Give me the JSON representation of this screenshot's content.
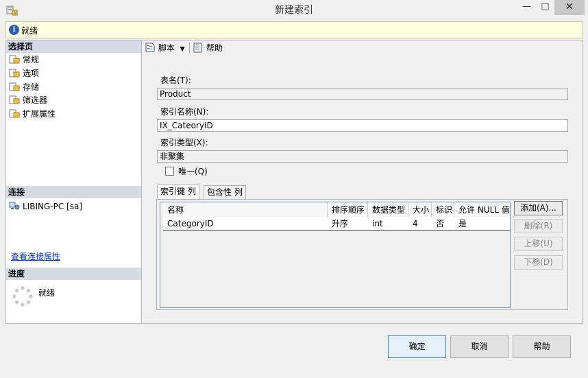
{
  "window": {
    "title": "新建索引"
  },
  "status": {
    "text": "就绪"
  },
  "left": {
    "select_page_header": "选择页",
    "pages": [
      {
        "label": "常规"
      },
      {
        "label": "选项"
      },
      {
        "label": "存储"
      },
      {
        "label": "筛选器"
      },
      {
        "label": "扩展属性"
      }
    ],
    "connection_header": "连接",
    "connection_name": "LIBING-PC [sa]",
    "view_connection_link": "查看连接属性",
    "progress_header": "进度",
    "progress_text": "就绪"
  },
  "toolbar": {
    "script_label": "脚本",
    "help_label": "帮助"
  },
  "form": {
    "table_name_label": "表名(T):",
    "table_name_value": "Product",
    "index_name_label": "索引名称(N):",
    "index_name_value": "IX_CateoryID",
    "index_type_label": "索引类型(X):",
    "index_type_value": "非聚集",
    "unique_label": "唯一(Q)"
  },
  "tabs": [
    {
      "label": "索引键 列"
    },
    {
      "label": "包含性 列"
    }
  ],
  "grid": {
    "columns": [
      "名称",
      "排序顺序",
      "数据类型",
      "大小",
      "标识",
      "允许 NULL 值"
    ],
    "rows": [
      [
        "CategoryID",
        "升序",
        "int",
        "4",
        "否",
        "是"
      ]
    ]
  },
  "side_buttons": {
    "add": "添加(A)...",
    "remove": "删除(R)",
    "move_up": "上移(U)",
    "move_down": "下移(D)"
  },
  "bottom_buttons": {
    "ok": "确定",
    "cancel": "取消",
    "help": "帮助"
  },
  "colors": {
    "status_bg": "#ffffe1",
    "section_header": "#d5dbe4",
    "link": "#0033cc",
    "default_button_border": "#3c7fb1"
  }
}
